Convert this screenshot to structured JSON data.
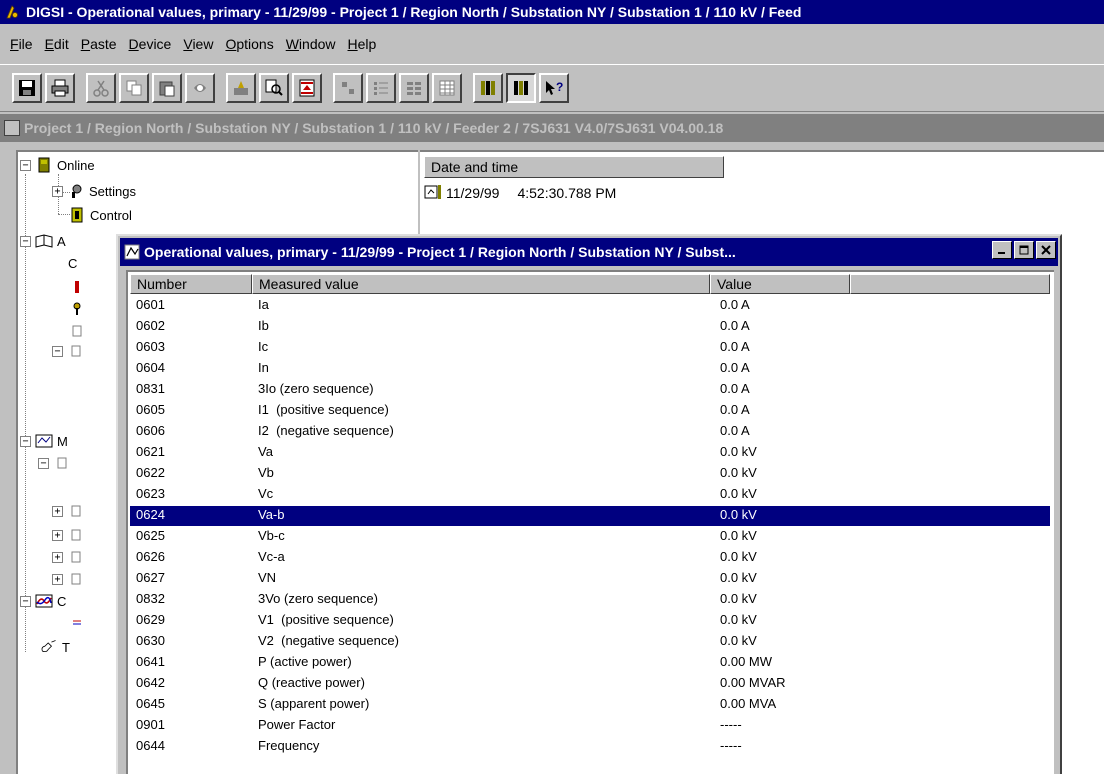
{
  "app": {
    "title": "DIGSI - Operational values, primary - 11/29/99 - Project 1 / Region North / Substation NY / Substation 1 / 110 kV / Feed"
  },
  "menu": {
    "items": [
      "File",
      "Edit",
      "Paste",
      "Device",
      "View",
      "Options",
      "Window",
      "Help"
    ]
  },
  "toolbar": {
    "buttons": [
      "save-icon",
      "print-icon",
      "cut-icon",
      "copy-icon",
      "paste-icon",
      "properties-icon",
      "device-icon",
      "find-icon",
      "filter-icon",
      "small-icons-icon",
      "list-icon",
      "details-icon",
      "table-icon",
      "columns-icon",
      "columns-active-icon",
      "help-pointer-icon"
    ]
  },
  "child_window": {
    "title": "Project 1 / Region North / Substation NY / Substation 1 / 110 kV / Feeder 2 / 7SJ631 V4.0/7SJ631 V04.00.18"
  },
  "tree": {
    "items": [
      {
        "label": "Online"
      },
      {
        "label": "Settings"
      },
      {
        "label": "Control"
      },
      {
        "label": "A"
      },
      {
        "label": "C"
      },
      {
        "label": "M"
      },
      {
        "label": "C"
      },
      {
        "label": "T"
      }
    ]
  },
  "right_panel": {
    "header": "Date and time",
    "row_date": "11/29/99",
    "row_time": "4:52:30.788 PM"
  },
  "op_window": {
    "title": "Operational values, primary - 11/29/99 - Project 1 / Region North / Substation NY / Subst...",
    "columns": [
      "Number",
      "Measured value",
      "Value"
    ],
    "selected_index": 10,
    "rows": [
      {
        "number": "0601",
        "name": "Ia",
        "value": "0.0 A"
      },
      {
        "number": "0602",
        "name": "Ib",
        "value": "0.0 A"
      },
      {
        "number": "0603",
        "name": "Ic",
        "value": "0.0 A"
      },
      {
        "number": "0604",
        "name": "In",
        "value": "0.0 A"
      },
      {
        "number": "0831",
        "name": "3Io (zero sequence)",
        "value": "0.0 A"
      },
      {
        "number": "0605",
        "name": "I1  (positive sequence)",
        "value": "0.0 A"
      },
      {
        "number": "0606",
        "name": "I2  (negative sequence)",
        "value": "0.0 A"
      },
      {
        "number": "0621",
        "name": "Va",
        "value": "0.0 kV"
      },
      {
        "number": "0622",
        "name": "Vb",
        "value": "0.0 kV"
      },
      {
        "number": "0623",
        "name": "Vc",
        "value": "0.0 kV"
      },
      {
        "number": "0624",
        "name": "Va-b",
        "value": "0.0 kV"
      },
      {
        "number": "0625",
        "name": "Vb-c",
        "value": "0.0 kV"
      },
      {
        "number": "0626",
        "name": "Vc-a",
        "value": "0.0 kV"
      },
      {
        "number": "0627",
        "name": "VN",
        "value": "0.0 kV"
      },
      {
        "number": "0832",
        "name": "3Vo (zero sequence)",
        "value": "0.0 kV"
      },
      {
        "number": "0629",
        "name": "V1  (positive sequence)",
        "value": "0.0 kV"
      },
      {
        "number": "0630",
        "name": "V2  (negative sequence)",
        "value": "0.0 kV"
      },
      {
        "number": "0641",
        "name": "P (active power)",
        "value": "0.00 MW"
      },
      {
        "number": "0642",
        "name": "Q (reactive power)",
        "value": "0.00 MVAR"
      },
      {
        "number": "0645",
        "name": "S (apparent power)",
        "value": "0.00 MVA"
      },
      {
        "number": "0901",
        "name": "Power Factor",
        "value": "-----"
      },
      {
        "number": "0644",
        "name": "Frequency",
        "value": "-----"
      }
    ]
  }
}
